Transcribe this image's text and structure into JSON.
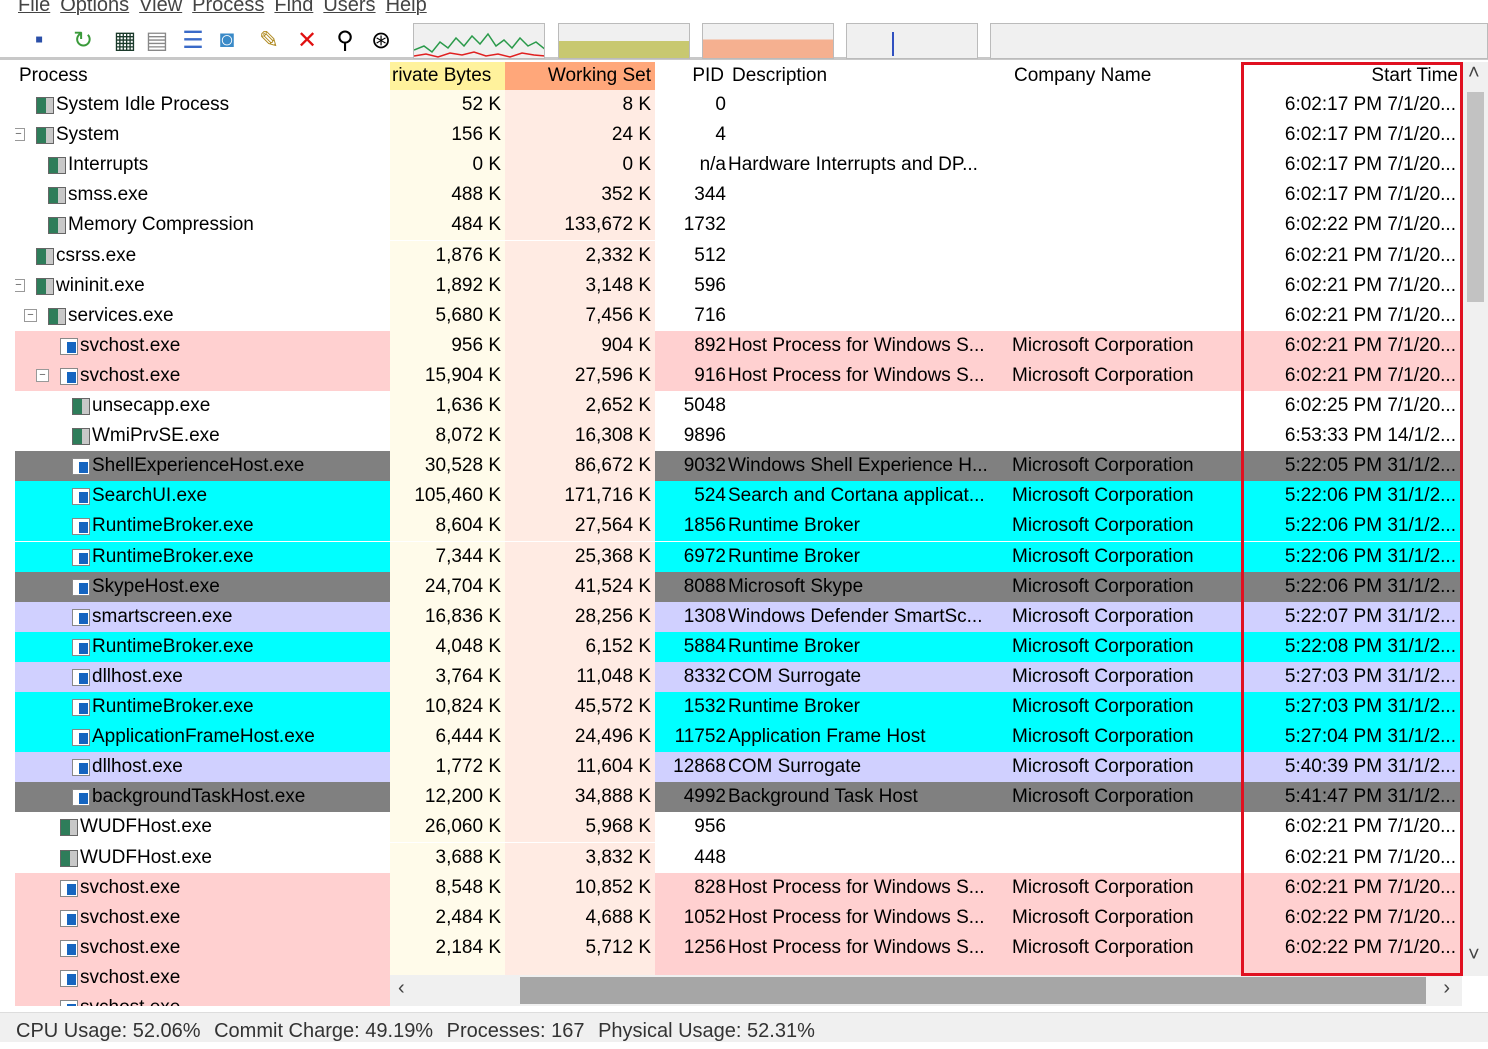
{
  "menu": [
    "File",
    "Options",
    "View",
    "Process",
    "Find",
    "Users",
    "Help"
  ],
  "toolbar": {
    "icons": [
      "save-icon",
      "refresh-icon",
      "system-info-icon",
      "handles-icon",
      "lower-pane-icon",
      "dll-icon",
      "properties-icon",
      "kill-process-icon",
      "find-icon",
      "target-icon"
    ],
    "graphs": [
      "cpu-graph",
      "commit-graph",
      "physical-memory-graph",
      "io-graph",
      "network-graph"
    ]
  },
  "columns": {
    "process": "Process",
    "private_bytes": "rivate Bytes",
    "working_set": "Working Set",
    "pid": "PID",
    "description": "Description",
    "company": "Company Name",
    "start_time": "Start Time"
  },
  "colors": {
    "service": "#ffd0d0",
    "suspended": "#808080",
    "immersive": "#00ffff",
    "own": "#d0d0ff",
    "private_bytes_header": "#fff29c",
    "working_set_header": "#ffa77a",
    "highlight_box": "#e01020"
  },
  "rows": [
    {
      "name": "System Idle Process",
      "level": 1,
      "icon": "window",
      "pb": "52 K",
      "ws": "8 K",
      "pid": "0",
      "desc": "",
      "company": "",
      "start": "6:02:17 PM 7/1/20..."
    },
    {
      "name": "System",
      "level": 1,
      "icon": "window",
      "expander": "−",
      "pb": "156 K",
      "ws": "24 K",
      "pid": "4",
      "desc": "",
      "company": "",
      "start": "6:02:17 PM 7/1/20..."
    },
    {
      "name": "Interrupts",
      "level": 2,
      "icon": "window",
      "pb": "0 K",
      "ws": "0 K",
      "pid": "n/a",
      "desc": "Hardware Interrupts and DP...",
      "company": "",
      "start": "6:02:17 PM 7/1/20..."
    },
    {
      "name": "smss.exe",
      "level": 2,
      "icon": "window",
      "pb": "488 K",
      "ws": "352 K",
      "pid": "344",
      "desc": "",
      "company": "",
      "start": "6:02:17 PM 7/1/20..."
    },
    {
      "name": "Memory Compression",
      "level": 2,
      "icon": "window",
      "pb": "484 K",
      "ws": "133,672 K",
      "pid": "1732",
      "desc": "",
      "company": "",
      "start": "6:02:22 PM 7/1/20..."
    },
    {
      "name": "csrss.exe",
      "level": 1,
      "icon": "window",
      "pb": "1,876 K",
      "ws": "2,332 K",
      "pid": "512",
      "desc": "",
      "company": "",
      "start": "6:02:21 PM 7/1/20..."
    },
    {
      "name": "wininit.exe",
      "level": 1,
      "icon": "window",
      "expander": "−",
      "pb": "1,892 K",
      "ws": "3,148 K",
      "pid": "596",
      "desc": "",
      "company": "",
      "start": "6:02:21 PM 7/1/20..."
    },
    {
      "name": "services.exe",
      "level": 2,
      "icon": "window",
      "expander": "−",
      "pb": "5,680 K",
      "ws": "7,456 K",
      "pid": "716",
      "desc": "",
      "company": "",
      "start": "6:02:21 PM 7/1/20..."
    },
    {
      "name": "svchost.exe",
      "level": 3,
      "icon": "service",
      "color": "service",
      "pb": "956 K",
      "ws": "904 K",
      "pid": "892",
      "desc": "Host Process for Windows S...",
      "company": "Microsoft Corporation",
      "start": "6:02:21 PM 7/1/20..."
    },
    {
      "name": "svchost.exe",
      "level": 3,
      "icon": "service",
      "color": "service",
      "expander": "−",
      "pb": "15,904 K",
      "ws": "27,596 K",
      "pid": "916",
      "desc": "Host Process for Windows S...",
      "company": "Microsoft Corporation",
      "start": "6:02:21 PM 7/1/20..."
    },
    {
      "name": "unsecapp.exe",
      "level": 4,
      "icon": "window",
      "pb": "1,636 K",
      "ws": "2,652 K",
      "pid": "5048",
      "desc": "",
      "company": "",
      "start": "6:02:25 PM 7/1/20..."
    },
    {
      "name": "WmiPrvSE.exe",
      "level": 4,
      "icon": "window",
      "pb": "8,072 K",
      "ws": "16,308 K",
      "pid": "9896",
      "desc": "",
      "company": "",
      "start": "6:53:33 PM 14/1/2..."
    },
    {
      "name": "ShellExperienceHost.exe",
      "level": 4,
      "icon": "service",
      "color": "suspended",
      "pb": "30,528 K",
      "ws": "86,672 K",
      "pid": "9032",
      "desc": "Windows Shell Experience H...",
      "company": "Microsoft Corporation",
      "start": "5:22:05 PM 31/1/2..."
    },
    {
      "name": "SearchUI.exe",
      "level": 4,
      "icon": "service",
      "color": "immersive",
      "pb": "105,460 K",
      "ws": "171,716 K",
      "pid": "524",
      "desc": "Search and Cortana applicat...",
      "company": "Microsoft Corporation",
      "start": "5:22:06 PM 31/1/2..."
    },
    {
      "name": "RuntimeBroker.exe",
      "level": 4,
      "icon": "service",
      "color": "immersive",
      "pb": "8,604 K",
      "ws": "27,564 K",
      "pid": "1856",
      "desc": "Runtime Broker",
      "company": "Microsoft Corporation",
      "start": "5:22:06 PM 31/1/2..."
    },
    {
      "name": "RuntimeBroker.exe",
      "level": 4,
      "icon": "service",
      "color": "immersive",
      "pb": "7,344 K",
      "ws": "25,368 K",
      "pid": "6972",
      "desc": "Runtime Broker",
      "company": "Microsoft Corporation",
      "start": "5:22:06 PM 31/1/2..."
    },
    {
      "name": "SkypeHost.exe",
      "level": 4,
      "icon": "service",
      "color": "suspended",
      "pb": "24,704 K",
      "ws": "41,524 K",
      "pid": "8088",
      "desc": "Microsoft Skype",
      "company": "Microsoft Corporation",
      "start": "5:22:06 PM 31/1/2..."
    },
    {
      "name": "smartscreen.exe",
      "level": 4,
      "icon": "service",
      "color": "own",
      "pb": "16,836 K",
      "ws": "28,256 K",
      "pid": "1308",
      "desc": "Windows Defender SmartSc...",
      "company": "Microsoft Corporation",
      "start": "5:22:07 PM 31/1/2..."
    },
    {
      "name": "RuntimeBroker.exe",
      "level": 4,
      "icon": "service",
      "color": "immersive",
      "pb": "4,048 K",
      "ws": "6,152 K",
      "pid": "5884",
      "desc": "Runtime Broker",
      "company": "Microsoft Corporation",
      "start": "5:22:08 PM 31/1/2..."
    },
    {
      "name": "dllhost.exe",
      "level": 4,
      "icon": "service",
      "color": "own",
      "pb": "3,764 K",
      "ws": "11,048 K",
      "pid": "8332",
      "desc": "COM Surrogate",
      "company": "Microsoft Corporation",
      "start": "5:27:03 PM 31/1/2..."
    },
    {
      "name": "RuntimeBroker.exe",
      "level": 4,
      "icon": "service",
      "color": "immersive",
      "pb": "10,824 K",
      "ws": "45,572 K",
      "pid": "1532",
      "desc": "Runtime Broker",
      "company": "Microsoft Corporation",
      "start": "5:27:03 PM 31/1/2..."
    },
    {
      "name": "ApplicationFrameHost.exe",
      "level": 4,
      "icon": "service",
      "color": "immersive",
      "pb": "6,444 K",
      "ws": "24,496 K",
      "pid": "11752",
      "desc": "Application Frame Host",
      "company": "Microsoft Corporation",
      "start": "5:27:04 PM 31/1/2..."
    },
    {
      "name": "dllhost.exe",
      "level": 4,
      "icon": "service",
      "color": "own",
      "pb": "1,772 K",
      "ws": "11,604 K",
      "pid": "12868",
      "desc": "COM Surrogate",
      "company": "Microsoft Corporation",
      "start": "5:40:39 PM 31/1/2..."
    },
    {
      "name": "backgroundTaskHost.exe",
      "level": 4,
      "icon": "service",
      "color": "suspended",
      "pb": "12,200 K",
      "ws": "34,888 K",
      "pid": "4992",
      "desc": "Background Task Host",
      "company": "Microsoft Corporation",
      "start": "5:41:47 PM 31/1/2..."
    },
    {
      "name": "WUDFHost.exe",
      "level": 3,
      "icon": "window",
      "pb": "26,060 K",
      "ws": "5,968 K",
      "pid": "956",
      "desc": "",
      "company": "",
      "start": "6:02:21 PM 7/1/20..."
    },
    {
      "name": "WUDFHost.exe",
      "level": 3,
      "icon": "window",
      "pb": "3,688 K",
      "ws": "3,832 K",
      "pid": "448",
      "desc": "",
      "company": "",
      "start": "6:02:21 PM 7/1/20..."
    },
    {
      "name": "svchost.exe",
      "level": 3,
      "icon": "service",
      "color": "service",
      "pb": "8,548 K",
      "ws": "10,852 K",
      "pid": "828",
      "desc": "Host Process for Windows S...",
      "company": "Microsoft Corporation",
      "start": "6:02:21 PM 7/1/20..."
    },
    {
      "name": "svchost.exe",
      "level": 3,
      "icon": "service",
      "color": "service",
      "pb": "2,484 K",
      "ws": "4,688 K",
      "pid": "1052",
      "desc": "Host Process for Windows S...",
      "company": "Microsoft Corporation",
      "start": "6:02:22 PM 7/1/20..."
    },
    {
      "name": "svchost.exe",
      "level": 3,
      "icon": "service",
      "color": "service",
      "pb": "2,184 K",
      "ws": "5,712 K",
      "pid": "1256",
      "desc": "Host Process for Windows S...",
      "company": "Microsoft Corporation",
      "start": "6:02:22 PM 7/1/20..."
    },
    {
      "name": "svchost.exe",
      "level": 3,
      "icon": "service",
      "color": "service",
      "pb": "",
      "ws": "",
      "pid": "",
      "desc": "",
      "company": "",
      "start": ""
    },
    {
      "name": "svchost.exe",
      "level": 3,
      "icon": "service",
      "color": "service",
      "pb": "",
      "ws": "",
      "pid": "",
      "desc": "",
      "company": "",
      "start": ""
    }
  ],
  "status": {
    "cpu": "CPU Usage: 52.06%",
    "commit": "Commit Charge: 49.19%",
    "processes": "Processes: 167",
    "physical": "Physical Usage: 52.31%"
  }
}
